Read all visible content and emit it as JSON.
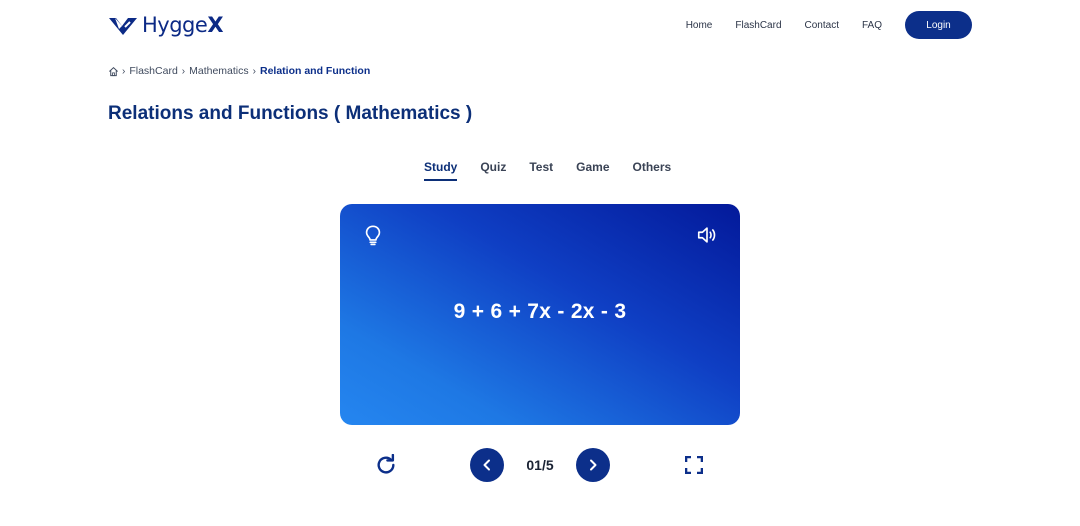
{
  "header": {
    "brand_name": "Hygge",
    "brand_suffix": "X",
    "nav": [
      {
        "label": "Home"
      },
      {
        "label": "FlashCard"
      },
      {
        "label": "Contact"
      },
      {
        "label": "FAQ"
      }
    ],
    "login_label": "Login"
  },
  "breadcrumb": {
    "items": [
      "FlashCard",
      "Mathematics",
      "Relation and Function"
    ]
  },
  "page": {
    "title": "Relations and Functions ( Mathematics )"
  },
  "tabs": [
    {
      "label": "Study",
      "active": true
    },
    {
      "label": "Quiz",
      "active": false
    },
    {
      "label": "Test",
      "active": false
    },
    {
      "label": "Game",
      "active": false
    },
    {
      "label": "Others",
      "active": false
    }
  ],
  "flashcard": {
    "content": "9 + 6 + 7x - 2x - 3",
    "hint_icon": "lightbulb-icon",
    "audio_icon": "speaker-icon"
  },
  "controls": {
    "counter": "01/5"
  },
  "colors": {
    "brand": "#0c2f8a",
    "card_gradient_start": "#03199a",
    "card_gradient_end": "#2586f0"
  }
}
